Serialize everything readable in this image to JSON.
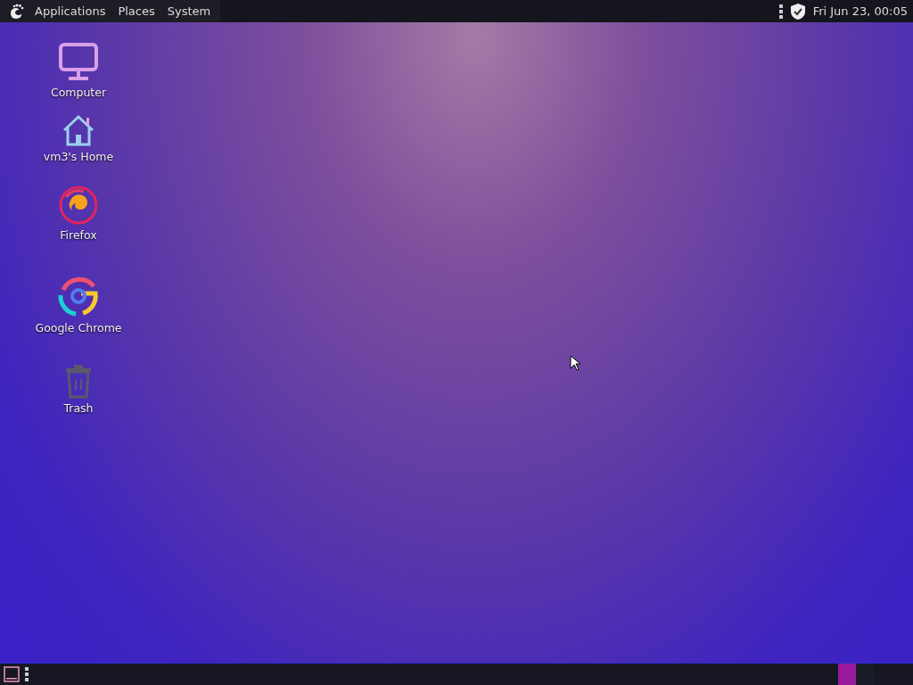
{
  "top_panel": {
    "menus": [
      {
        "label": "Applications"
      },
      {
        "label": "Places"
      },
      {
        "label": "System"
      }
    ],
    "clock": "Fri Jun 23, 00:05"
  },
  "desktop_icons": [
    {
      "kind": "computer",
      "label": "Computer"
    },
    {
      "kind": "home",
      "label": "vm3's Home"
    },
    {
      "kind": "firefox",
      "label": "Firefox"
    },
    {
      "kind": "chrome",
      "label": "Google Chrome"
    },
    {
      "kind": "trash",
      "label": "Trash"
    }
  ],
  "bottom_panel": {
    "workspaces": [
      {
        "selected": true
      },
      {
        "selected": false
      }
    ]
  }
}
